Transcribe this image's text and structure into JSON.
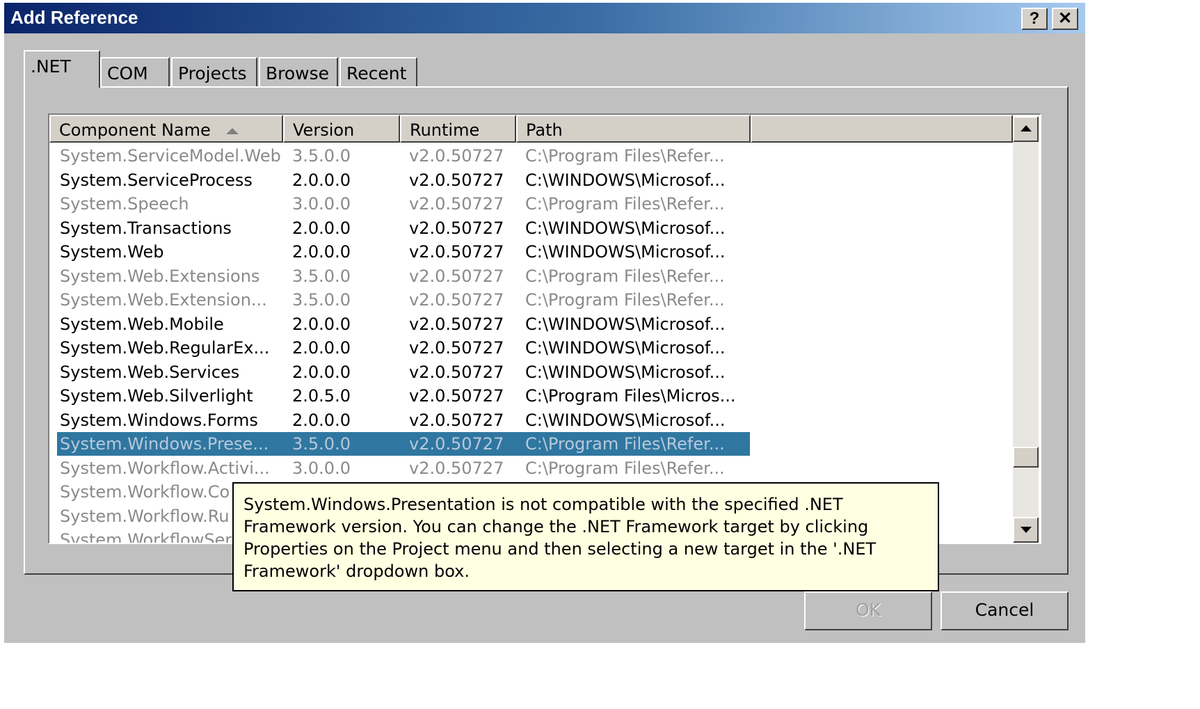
{
  "window": {
    "title": "Add Reference",
    "help_label": "?",
    "close_label": "✕"
  },
  "tabs": [
    {
      "label": ".NET",
      "active": true
    },
    {
      "label": "COM",
      "active": false
    },
    {
      "label": "Projects",
      "active": false
    },
    {
      "label": "Browse",
      "active": false
    },
    {
      "label": "Recent",
      "active": false
    }
  ],
  "table": {
    "columns": [
      "Component Name",
      "Version",
      "Runtime",
      "Path"
    ],
    "sort_icon": "sort-ascending-icon",
    "rows": [
      {
        "name": "System.ServiceModel.Web",
        "version": "3.5.0.0",
        "runtime": "v2.0.50727",
        "path": "C:\\Program Files\\Refer...",
        "state": "dim"
      },
      {
        "name": "System.ServiceProcess",
        "version": "2.0.0.0",
        "runtime": "v2.0.50727",
        "path": "C:\\WINDOWS\\Microsof...",
        "state": "normal"
      },
      {
        "name": "System.Speech",
        "version": "3.0.0.0",
        "runtime": "v2.0.50727",
        "path": "C:\\Program Files\\Refer...",
        "state": "dim"
      },
      {
        "name": "System.Transactions",
        "version": "2.0.0.0",
        "runtime": "v2.0.50727",
        "path": "C:\\WINDOWS\\Microsof...",
        "state": "normal"
      },
      {
        "name": "System.Web",
        "version": "2.0.0.0",
        "runtime": "v2.0.50727",
        "path": "C:\\WINDOWS\\Microsof...",
        "state": "normal"
      },
      {
        "name": "System.Web.Extensions",
        "version": "3.5.0.0",
        "runtime": "v2.0.50727",
        "path": "C:\\Program Files\\Refer...",
        "state": "dim"
      },
      {
        "name": "System.Web.Extension...",
        "version": "3.5.0.0",
        "runtime": "v2.0.50727",
        "path": "C:\\Program Files\\Refer...",
        "state": "dim"
      },
      {
        "name": "System.Web.Mobile",
        "version": "2.0.0.0",
        "runtime": "v2.0.50727",
        "path": "C:\\WINDOWS\\Microsof...",
        "state": "normal"
      },
      {
        "name": "System.Web.RegularEx...",
        "version": "2.0.0.0",
        "runtime": "v2.0.50727",
        "path": "C:\\WINDOWS\\Microsof...",
        "state": "normal"
      },
      {
        "name": "System.Web.Services",
        "version": "2.0.0.0",
        "runtime": "v2.0.50727",
        "path": "C:\\WINDOWS\\Microsof...",
        "state": "normal"
      },
      {
        "name": "System.Web.Silverlight",
        "version": "2.0.5.0",
        "runtime": "v2.0.50727",
        "path": "C:\\Program Files\\Micros...",
        "state": "normal"
      },
      {
        "name": "System.Windows.Forms",
        "version": "2.0.0.0",
        "runtime": "v2.0.50727",
        "path": "C:\\WINDOWS\\Microsof...",
        "state": "normal"
      },
      {
        "name": "System.Windows.Prese...",
        "version": "3.5.0.0",
        "runtime": "v2.0.50727",
        "path": "C:\\Program Files\\Refer...",
        "state": "selected"
      },
      {
        "name": "System.Workflow.Activi...",
        "version": "3.0.0.0",
        "runtime": "v2.0.50727",
        "path": "C:\\Program Files\\Refer...",
        "state": "dim"
      },
      {
        "name": "System.Workflow.Co",
        "version": "",
        "runtime": "",
        "path": "",
        "state": "dim"
      },
      {
        "name": "System.Workflow.Ru",
        "version": "",
        "runtime": "",
        "path": "",
        "state": "dim"
      },
      {
        "name": "System.WorkflowSer",
        "version": "",
        "runtime": "",
        "path": "",
        "state": "dim"
      }
    ]
  },
  "tooltip": {
    "text": "System.Windows.Presentation is not compatible with the specified .NET Framework version. You can change the .NET Framework target by clicking Properties on the Project menu and then selecting a new target in the '.NET Framework' dropdown box."
  },
  "buttons": {
    "ok_label": "OK",
    "cancel_label": "Cancel"
  },
  "colors": {
    "title_gradient_start": "#0a246a",
    "selection": "#2f77a0",
    "tooltip_bg": "#ffffe1",
    "dialog_bg": "#c0c0c0"
  }
}
